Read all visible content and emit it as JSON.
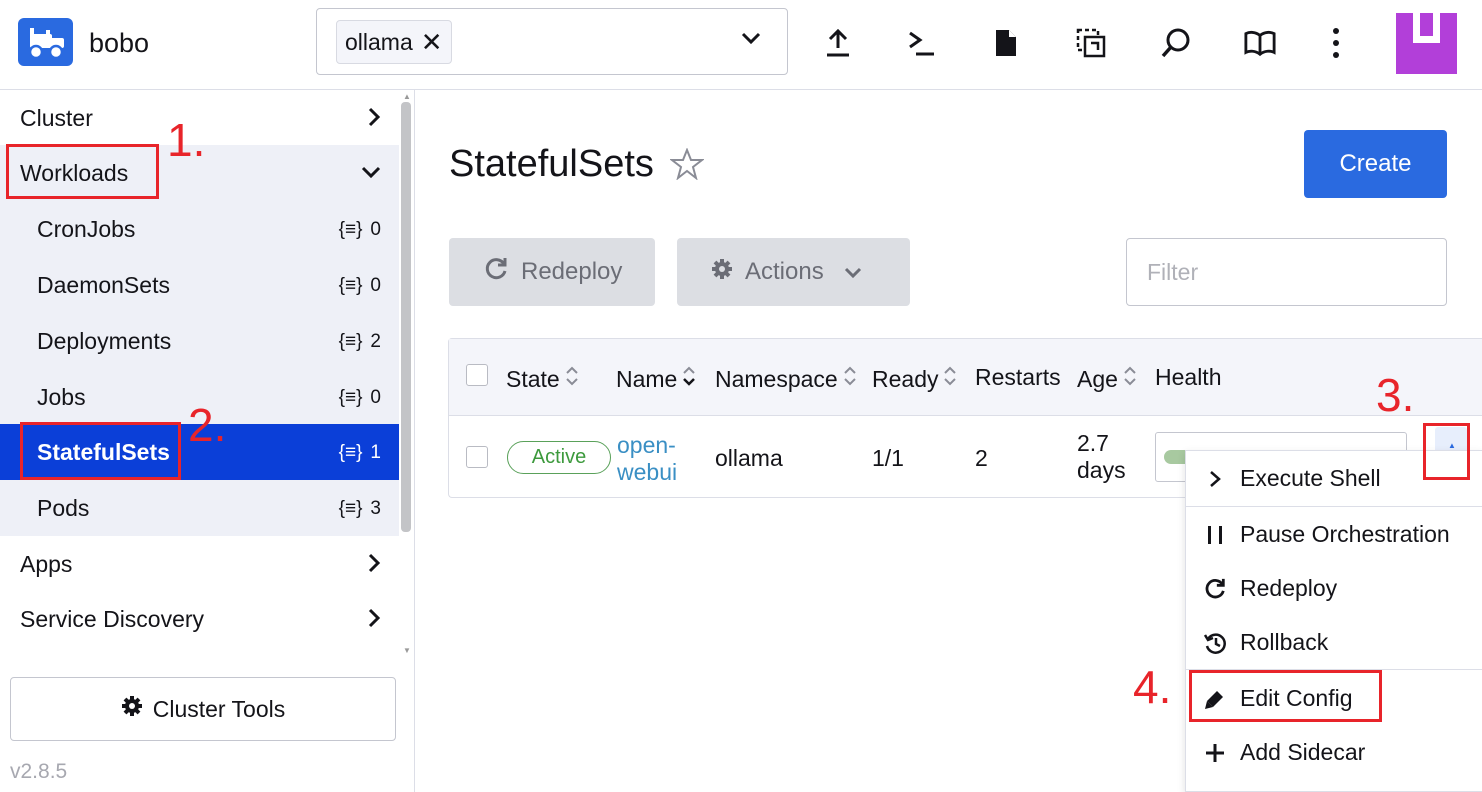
{
  "header": {
    "cluster_name": "bobo",
    "namespace_chip": "ollama",
    "namespace_chip_remove": "✕",
    "icons": [
      "upload-icon",
      "terminal-icon",
      "file-icon",
      "copy-kubeconfig-icon",
      "search-icon",
      "book-icon",
      "more-vertical-icon"
    ]
  },
  "sidebar": {
    "groups": {
      "cluster": "Cluster",
      "workloads": "Workloads",
      "apps": "Apps",
      "service_discovery": "Service Discovery"
    },
    "workloads": [
      {
        "label": "CronJobs",
        "count": "0"
      },
      {
        "label": "DaemonSets",
        "count": "0"
      },
      {
        "label": "Deployments",
        "count": "2"
      },
      {
        "label": "Jobs",
        "count": "0"
      },
      {
        "label": "StatefulSets",
        "count": "1"
      },
      {
        "label": "Pods",
        "count": "3"
      }
    ],
    "cluster_tools": "Cluster Tools",
    "version": "v2.8.5"
  },
  "main": {
    "title": "StatefulSets",
    "create_label": "Create",
    "redeploy_label": "Redeploy",
    "actions_label": "Actions",
    "filter_placeholder": "Filter",
    "columns": [
      "State",
      "Name",
      "Namespace",
      "Ready",
      "Restarts",
      "Age",
      "Health"
    ],
    "rows": [
      {
        "state": "Active",
        "name_line1": "open-",
        "name_line2": "webui",
        "namespace": "ollama",
        "ready": "1/1",
        "restarts": "2",
        "age_line1": "2.7",
        "age_line2": "days",
        "health_fraction": 0.12
      }
    ]
  },
  "menu": {
    "items": [
      {
        "label": "Execute Shell",
        "icon": "chevron-right-icon"
      },
      {
        "label": "Pause Orchestration",
        "icon": "pause-icon"
      },
      {
        "label": "Redeploy",
        "icon": "refresh-icon"
      },
      {
        "label": "Rollback",
        "icon": "history-icon"
      },
      {
        "label": "Edit Config",
        "icon": "pencil-icon"
      },
      {
        "label": "Add Sidecar",
        "icon": "plus-icon"
      }
    ]
  },
  "annotations": {
    "step1": "1.",
    "step2": "2.",
    "step3": "3.",
    "step4": "4."
  },
  "colors": {
    "accent": "#2a6ae0",
    "active_nav": "#0b3fd8",
    "annotation": "#e8242a",
    "active_badge": "#3d9a3d",
    "avatar": "#b23fd9"
  }
}
